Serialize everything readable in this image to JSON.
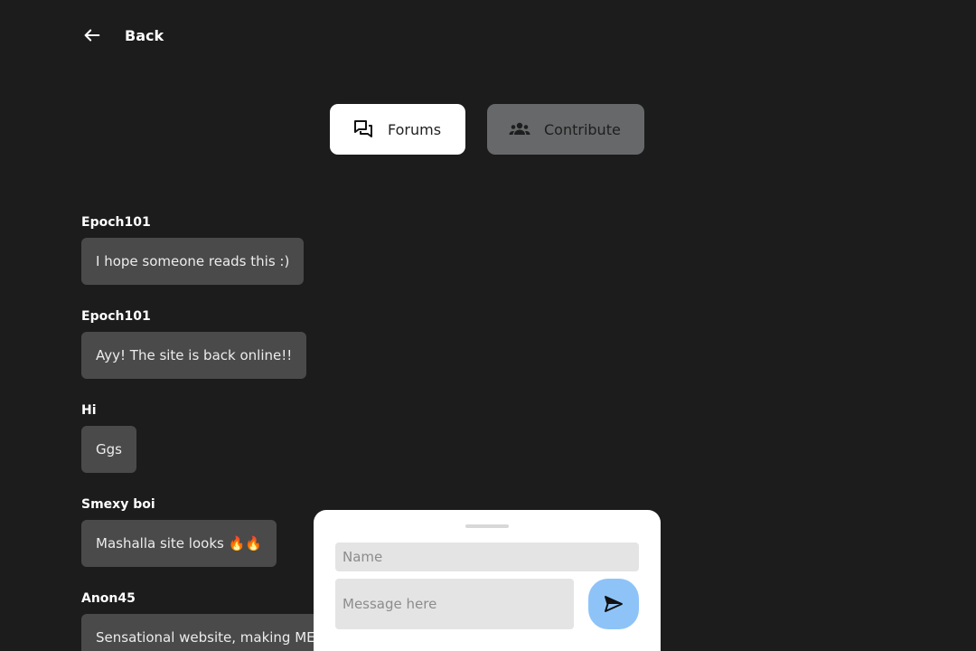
{
  "nav": {
    "back_label": "Back",
    "back_icon": "arrow-left-icon"
  },
  "tabs": [
    {
      "label": "Forums",
      "icon": "forum-icon",
      "active": true
    },
    {
      "label": "Contribute",
      "icon": "group-icon",
      "active": false
    }
  ],
  "messages": [
    {
      "author": "Epoch101",
      "text": "I hope someone reads this :)"
    },
    {
      "author": "Epoch101",
      "text": "Ayy! The site is back online!!"
    },
    {
      "author": "Hi",
      "text": "Ggs"
    },
    {
      "author": "Smexy boi",
      "text": "Mashalla site looks 🔥🔥"
    },
    {
      "author": "Anon45",
      "text": "Sensational website, making MEC"
    }
  ],
  "composer": {
    "name_placeholder": "Name",
    "message_placeholder": "Message here",
    "send_icon": "send-icon"
  },
  "colors": {
    "background": "#1c1c1c",
    "bubble": "#4a4a4a",
    "active_tab": "#ffffff",
    "inactive_tab": "#66686a",
    "send_button": "#8ec3f8"
  }
}
